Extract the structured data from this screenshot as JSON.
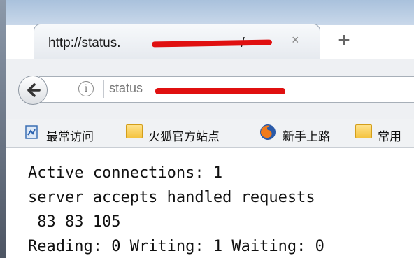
{
  "tab": {
    "title": "http://status.",
    "title_tail": "/",
    "close_glyph": "×",
    "new_tab_glyph": "+"
  },
  "navbar": {
    "info_glyph": "i",
    "url_prefix": "status"
  },
  "bookmarks": [
    {
      "label": "最常访问",
      "icon": "bookmark-page-icon"
    },
    {
      "label": "火狐官方站点",
      "icon": "folder-icon"
    },
    {
      "label": "新手上路",
      "icon": "firefox-icon"
    },
    {
      "label": "常用",
      "icon": "folder-icon"
    }
  ],
  "page": {
    "lines": [
      "Active connections: 1",
      "server accepts handled requests",
      " 83 83 105",
      "Reading: 0 Writing: 1 Waiting: 0"
    ]
  },
  "colors": {
    "redaction": "#e01010",
    "titlebar": "#b9cde4"
  }
}
